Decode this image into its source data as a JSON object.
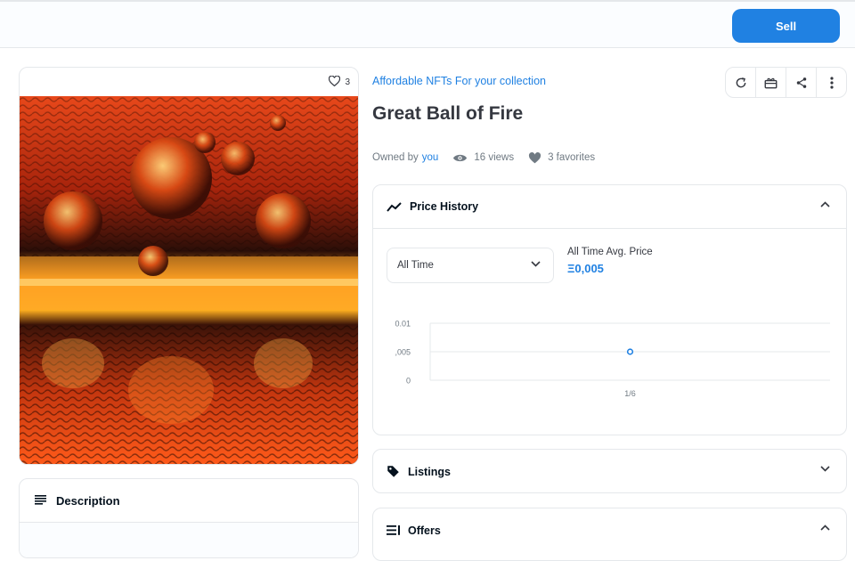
{
  "header": {
    "sell_label": "Sell"
  },
  "media": {
    "favorite_count": "3"
  },
  "description": {
    "title": "Description"
  },
  "item": {
    "collection": "Affordable NFTs For your collection",
    "title": "Great Ball of Fire",
    "owned_by_label": "Owned by",
    "owner": "you",
    "views": "16 views",
    "favorites": "3 favorites"
  },
  "actions": [
    "refresh-icon",
    "gift-icon",
    "share-icon",
    "more-vertical-icon"
  ],
  "price_history": {
    "title": "Price History",
    "range": "All Time",
    "avg_label": "All Time Avg. Price",
    "avg_value": "Ξ0,005"
  },
  "chart_data": {
    "type": "scatter",
    "x": [
      "1/6"
    ],
    "values": [
      0.005
    ],
    "ytick_labels": [
      "0.01",
      ",005",
      "0"
    ],
    "ylim": [
      0,
      0.01
    ],
    "grid": true,
    "point_color": "#2081e2"
  },
  "listings": {
    "title": "Listings"
  },
  "offers": {
    "title": "Offers"
  },
  "colors": {
    "accent": "#2081e2",
    "border": "#e5e8eb",
    "muted": "#707a83"
  }
}
